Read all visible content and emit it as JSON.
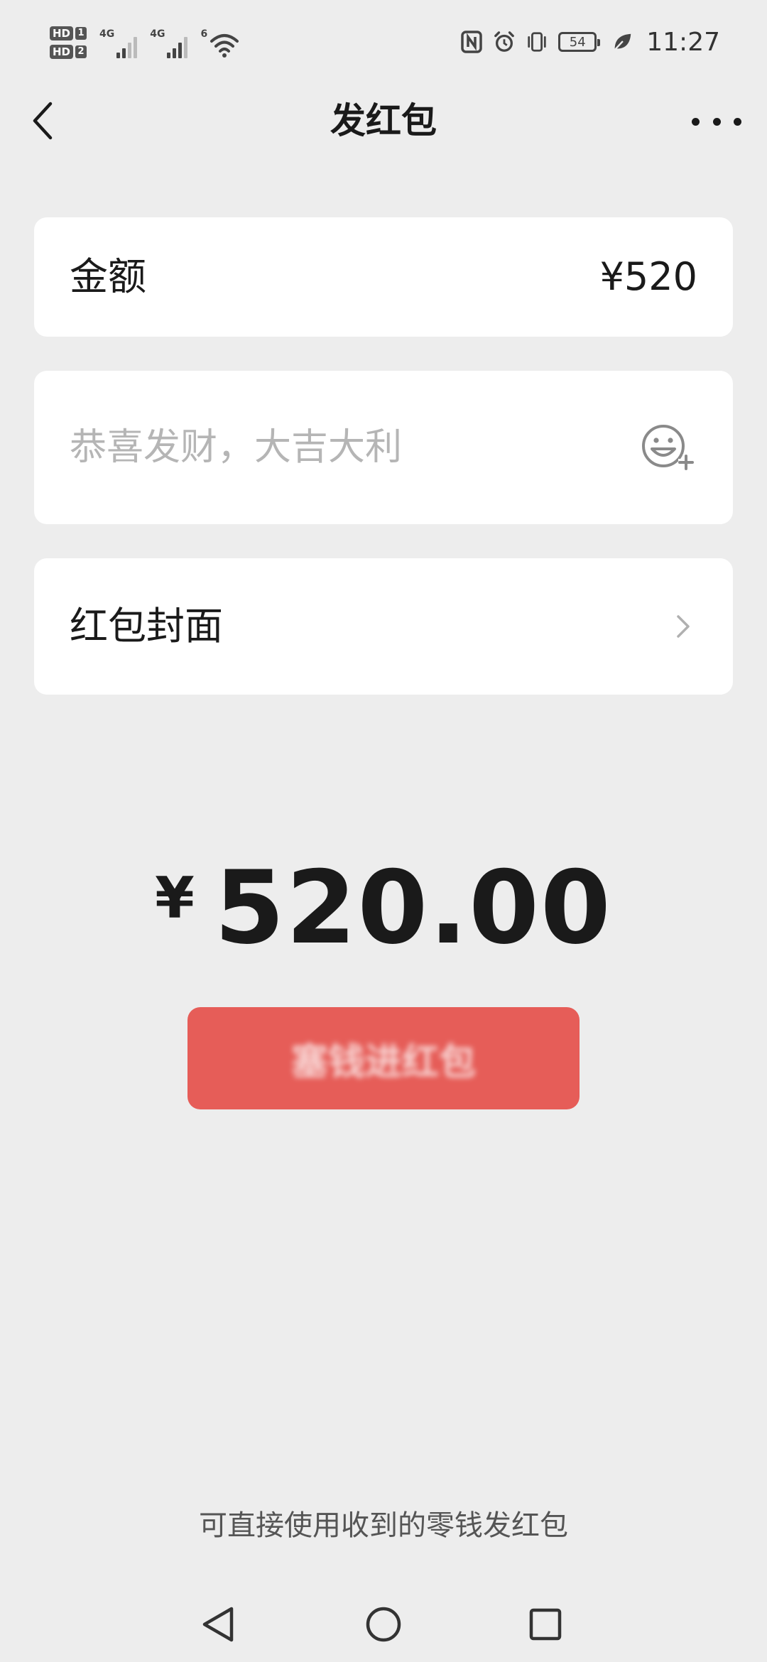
{
  "status_bar": {
    "hd1": "HD",
    "hd1_num": "1",
    "hd2": "HD",
    "hd2_num": "2",
    "net1": "4G",
    "net2": "4G",
    "net3": "6",
    "battery": "54",
    "time": "11:27",
    "icons": [
      "nfc-icon",
      "alarm-icon",
      "vibrate-icon",
      "battery-icon",
      "leaf-icon"
    ]
  },
  "nav": {
    "title": "发红包",
    "back_icon": "chevron-left-icon",
    "more_icon": "more-dots-icon"
  },
  "amount_row": {
    "label": "金额",
    "value": "¥520"
  },
  "greeting": {
    "placeholder": "恭喜发财，大吉大利",
    "value": "",
    "emoji_icon": "emoji-add-icon"
  },
  "cover_row": {
    "label": "红包封面",
    "chevron_icon": "chevron-right-icon"
  },
  "total": {
    "currency": "¥",
    "amount": "520.00"
  },
  "send_button": {
    "label": "塞钱进红包",
    "color": "#e65d58"
  },
  "footnote": "可直接使用收到的零钱发红包",
  "system_nav": {
    "icons": [
      "nav-back-icon",
      "nav-home-icon",
      "nav-recent-icon"
    ]
  }
}
